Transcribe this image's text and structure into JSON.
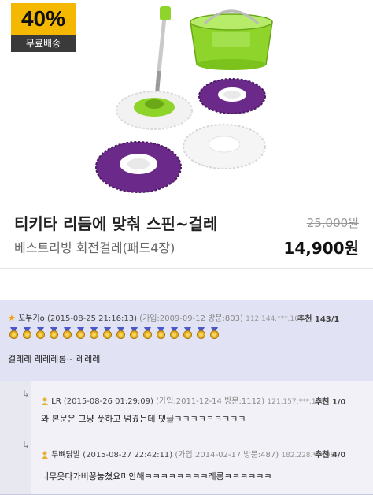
{
  "product": {
    "discount_badge": "40%",
    "shipping_badge": "무료배송",
    "title": "티키타 리듬에 맞춰 스핀~걸레",
    "subtitle": "베스트리빙 회전걸레(패드4장)",
    "original_price": "25,000원",
    "sale_price": "14,900원"
  },
  "comments": [
    {
      "icon": "star-icon",
      "name": "꼬부기o",
      "date": "(2015-08-25 21:16:13)",
      "joined": "(가입:2009-09-12 방문:803)",
      "ip": "112.144.***.104",
      "recommend": "추천 143/1",
      "text": "걸레레 레레레롱~ 레레레",
      "medal_count": 16
    },
    {
      "icon": "person-icon",
      "name": "LR",
      "date": "(2015-08-26 01:29:09)",
      "joined": "(가입:2011-12-14 방문:1112)",
      "ip": "121.157.***.133",
      "recommend": "추천 1/0",
      "text": "와 본문은 그냥 풋하고 넘겼는데 댓글ㅋㅋㅋㅋㅋㅋㅋㅋㅋ"
    },
    {
      "icon": "person-icon",
      "name": "무뼈닭발",
      "date": "(2015-08-27 22:42:11)",
      "joined": "(가입:2014-02-17 방문:487)",
      "ip": "182.228.***.98",
      "recommend": "추천 4/0",
      "text": "너무웃다가비꽁놓쳤요미안해ㅋㅋㅋㅋㅋㅋㅋㅋ레롱ㅋㅋㅋㅋㅋㅋ"
    }
  ],
  "colors": {
    "badge_yellow": "#f5b800",
    "mop_green": "#8ed42a",
    "pad_purple": "#6b2a8a"
  }
}
